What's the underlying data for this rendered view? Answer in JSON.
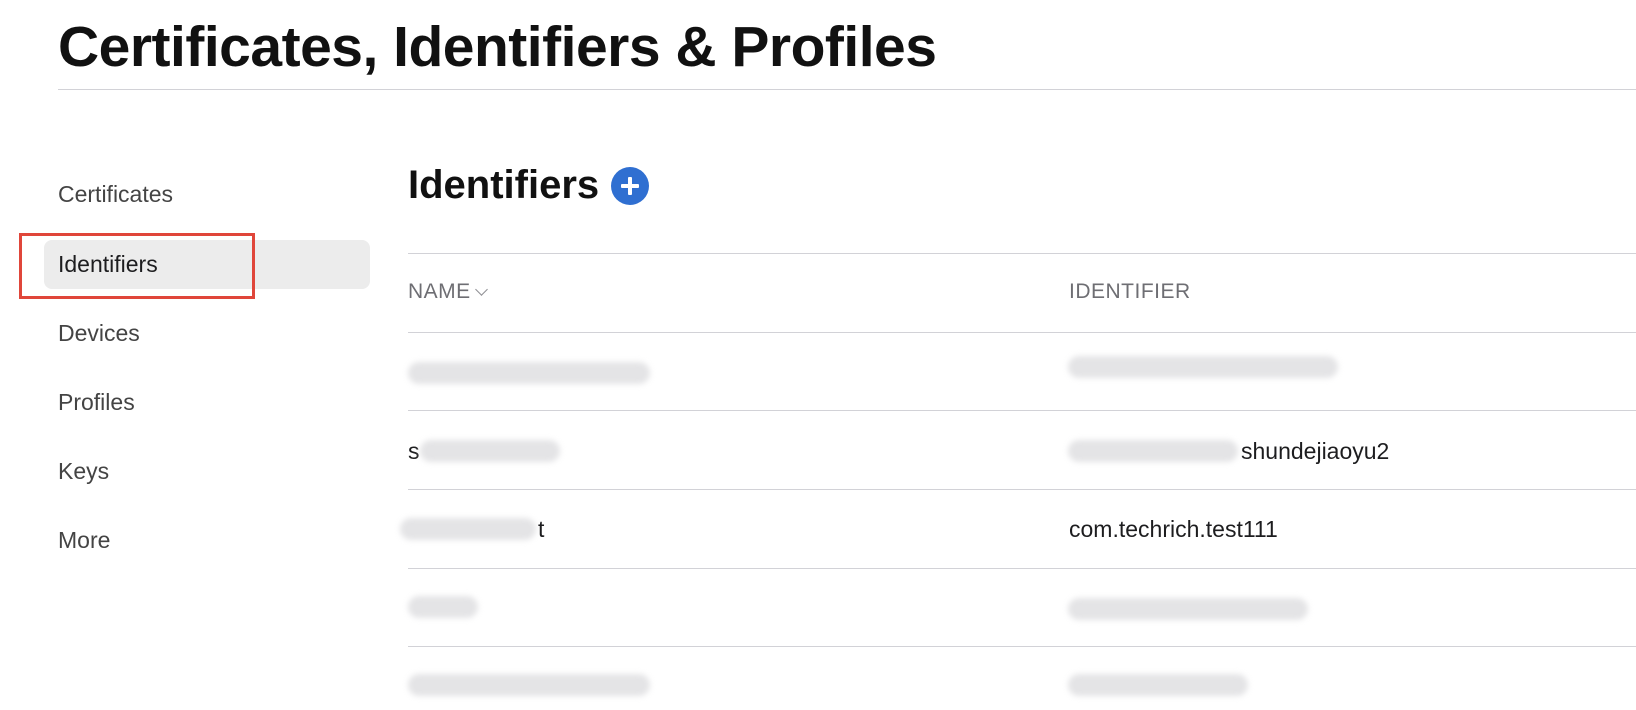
{
  "header": {
    "title": "Certificates, Identifiers & Profiles"
  },
  "sidebar": {
    "items": [
      {
        "label": "Certificates",
        "active": false
      },
      {
        "label": "Identifiers",
        "active": true
      },
      {
        "label": "Devices",
        "active": false
      },
      {
        "label": "Profiles",
        "active": false
      },
      {
        "label": "Keys",
        "active": false
      },
      {
        "label": "More",
        "active": false
      }
    ],
    "highlight_color": "#e0463a"
  },
  "main": {
    "title": "Identifiers",
    "add_icon": "plus-circle-icon",
    "accent_color": "#2f6fd1",
    "table": {
      "columns": [
        "NAME",
        "IDENTIFIER"
      ],
      "sort_icon": "chevron-down-icon",
      "rows": [
        {
          "name": "",
          "identifier": ""
        },
        {
          "name": "s",
          "identifier": "shundejiaoyu2"
        },
        {
          "name": "t",
          "identifier": "com.techrich.test111"
        },
        {
          "name": "",
          "identifier": ""
        },
        {
          "name": "",
          "identifier": ""
        }
      ]
    }
  }
}
